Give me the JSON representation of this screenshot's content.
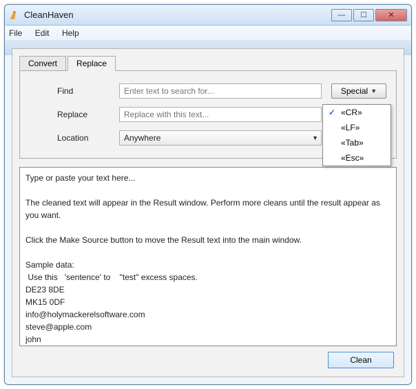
{
  "window": {
    "title": "CleanHaven"
  },
  "menubar": [
    "File",
    "Edit",
    "Help"
  ],
  "tabs": {
    "convert": "Convert",
    "replace": "Replace",
    "active": "replace"
  },
  "form": {
    "find_label": "Find",
    "find_placeholder": "Enter text to search for...",
    "replace_label": "Replace",
    "replace_placeholder": "Replace with this text...",
    "location_label": "Location",
    "location_value": "Anywhere",
    "special_label": "Special"
  },
  "special_dropdown": {
    "items": [
      "«CR»",
      "«LF»",
      "«Tab»",
      "«Esc»"
    ],
    "checked_index": 0
  },
  "textarea": "Type or paste your text here...\n\nThe cleaned text will appear in the Result window. Perform more cleans until the result appear as you want.\n\nClick the Make Source button to move the Result text into the main window.\n\nSample data:\n Use this   'sentence' to    \"test\" excess spaces.\nDE23 8DE\nMK15 0DF\ninfo@holymackerelsoftware.com\nsteve@apple.com\njohn\nmary\nbill\nsteve sarkoezy\npaul carter",
  "buttons": {
    "clean": "Clean"
  }
}
